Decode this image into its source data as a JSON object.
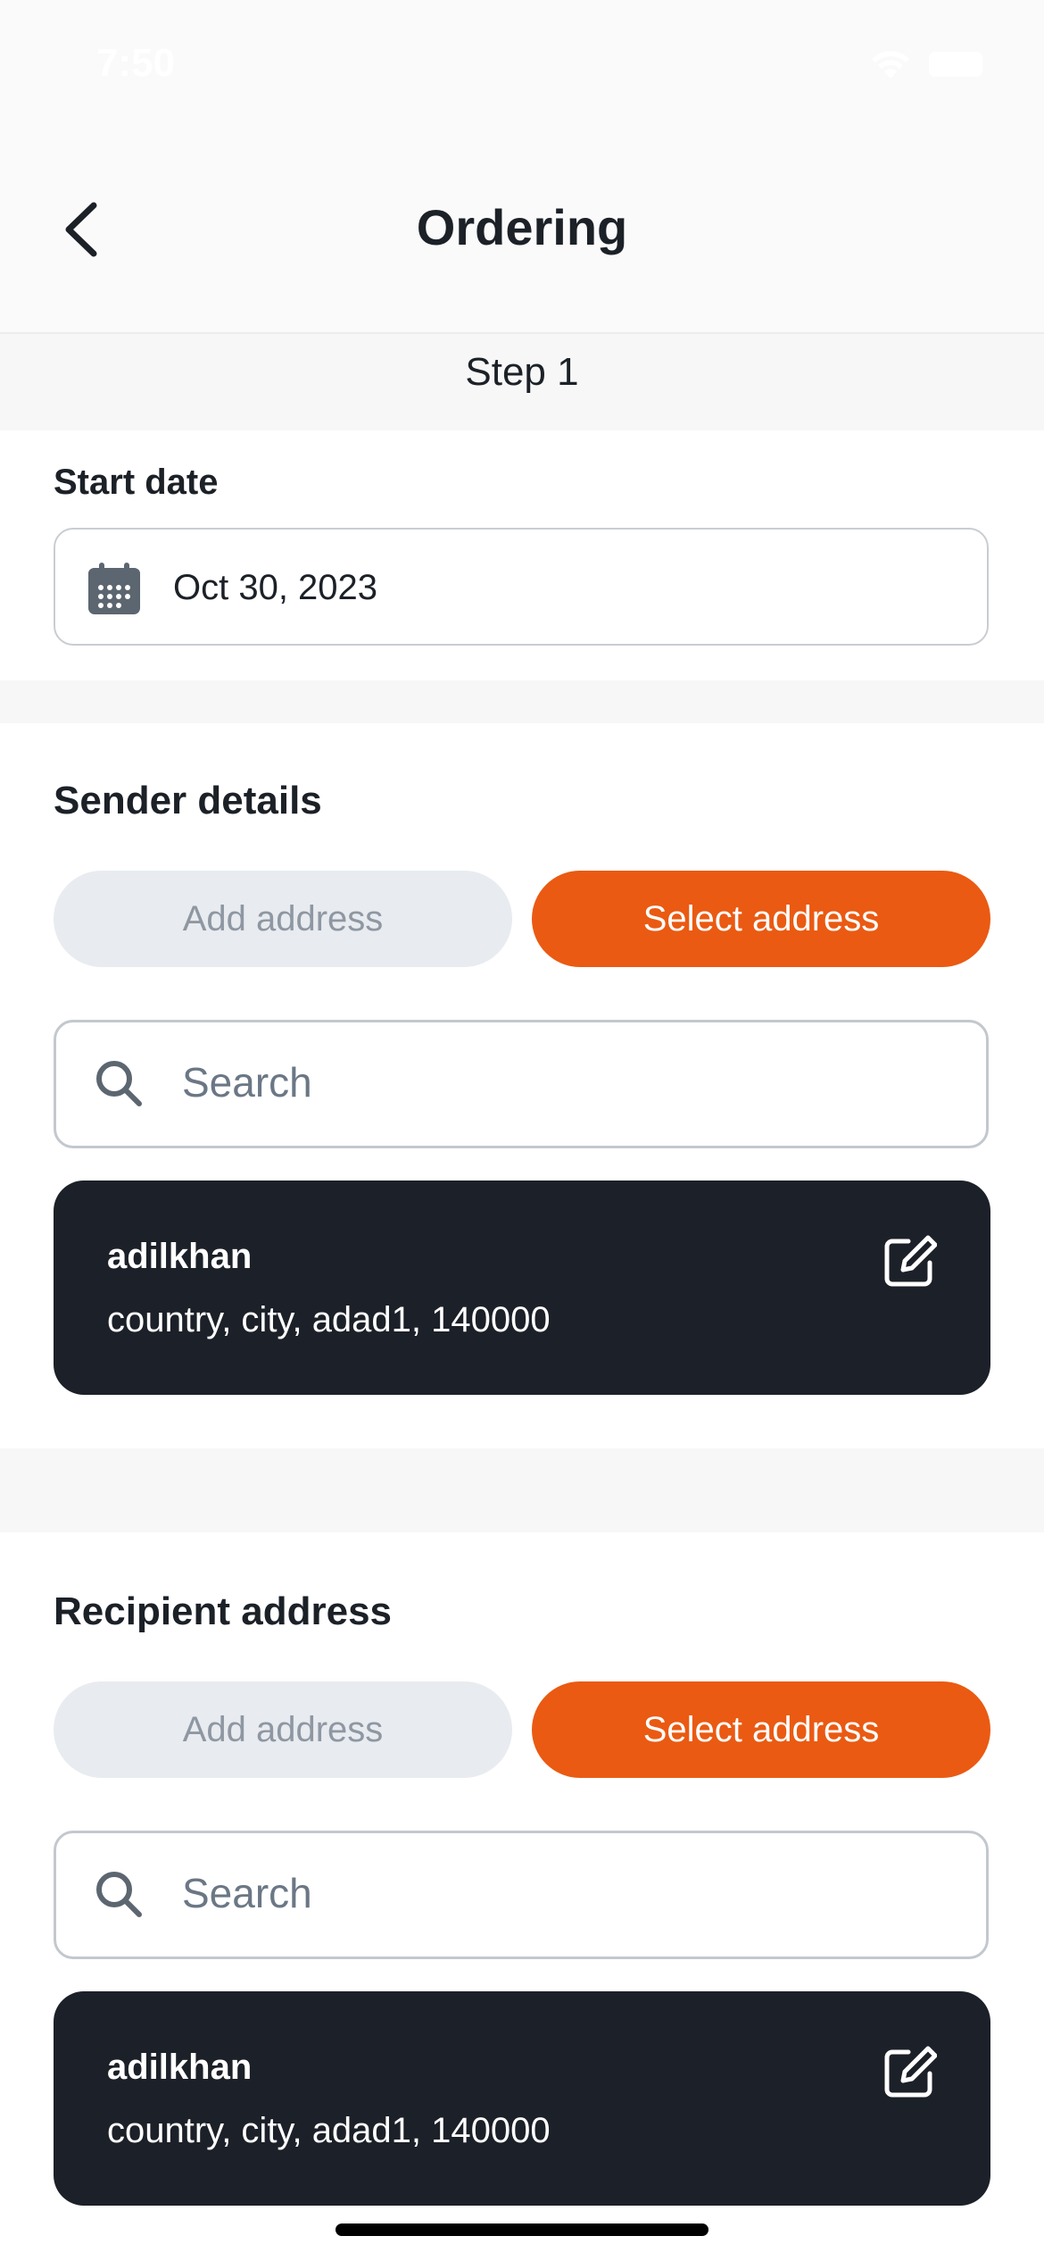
{
  "status_bar": {
    "time": "7:50"
  },
  "header": {
    "title": "Ordering"
  },
  "step": {
    "label": "Step 1"
  },
  "start_date": {
    "label": "Start date",
    "value": "Oct 30, 2023"
  },
  "sender": {
    "title": "Sender details",
    "add_address_label": "Add address",
    "select_address_label": "Select address",
    "search_placeholder": "Search",
    "card": {
      "name": "adilkhan",
      "address": "country, city, adad1, 140000"
    }
  },
  "recipient": {
    "title": "Recipient address",
    "add_address_label": "Add address",
    "select_address_label": "Select address",
    "search_placeholder": "Search",
    "card": {
      "name": "adilkhan",
      "address": "country, city, adad1, 140000"
    }
  },
  "colors": {
    "accent": "#ea5a12",
    "card_bg": "#1c2028",
    "muted_pill": "#e8ebef"
  }
}
